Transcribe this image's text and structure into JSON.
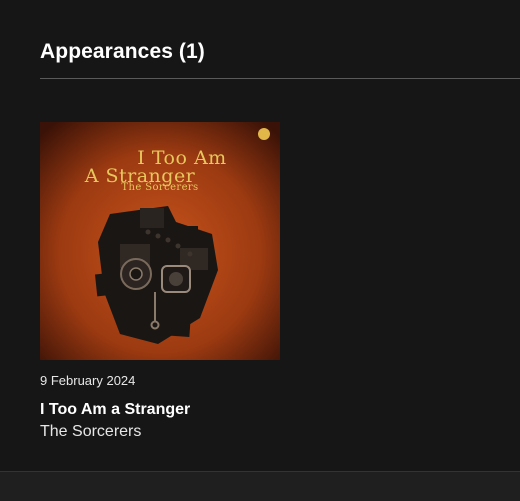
{
  "section": {
    "title": "Appearances (1)"
  },
  "release": {
    "date": "9 February 2024",
    "title": "I Too Am a Stranger",
    "artist": "The Sorcerers",
    "artwork": {
      "title_line1": "I Too Am",
      "title_line2": "A Stranger",
      "artist_line": "The Sorcerers",
      "logo_icon": "label-logo-icon"
    }
  },
  "colors": {
    "background": "#161616",
    "divider": "#5a5a5a",
    "artwork_bg": "#a23d12",
    "artwork_text": "#e7c75d"
  }
}
